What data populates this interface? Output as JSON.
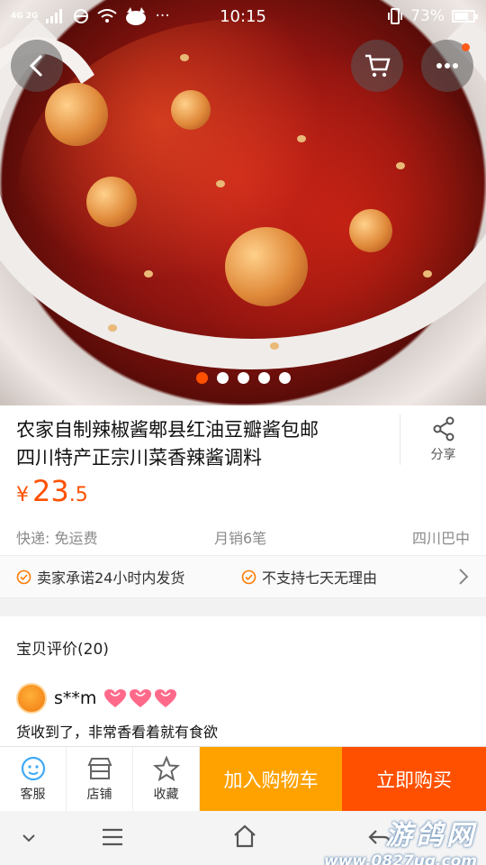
{
  "status_bar": {
    "network": "4G 2G",
    "time": "10:15",
    "battery": "73%",
    "more": "···"
  },
  "product": {
    "title_line1": "农家自制辣椒酱郫县红油豆瓣酱包邮",
    "title_line2": "四川特产正宗川菜香辣酱调料",
    "share_label": "分享",
    "price_currency": "¥",
    "price_int": "23",
    "price_dec": ".5",
    "shipping": "快递: 免运费",
    "monthly_sales": "月销6笔",
    "location": "四川巴中"
  },
  "carousel": {
    "count": 5,
    "active": 0
  },
  "guarantees": [
    "卖家承诺24小时内发货",
    "不支持七天无理由"
  ],
  "reviews": {
    "header": "宝贝评价(20)",
    "items": [
      {
        "user": "s**m",
        "text": "货收到了，非常香看着就有食欲"
      }
    ]
  },
  "action_bar": {
    "service_label": "客服",
    "shop_label": "店铺",
    "favorite_label": "收藏",
    "add_cart_label": "加入购物车",
    "buy_now_label": "立即购买"
  },
  "watermark": {
    "line1": "游鸽网",
    "line2": "www.0827ug.com"
  },
  "colors": {
    "accent": "#ff5000",
    "cart_button": "#ffa200",
    "buy_button": "#ff5000"
  }
}
